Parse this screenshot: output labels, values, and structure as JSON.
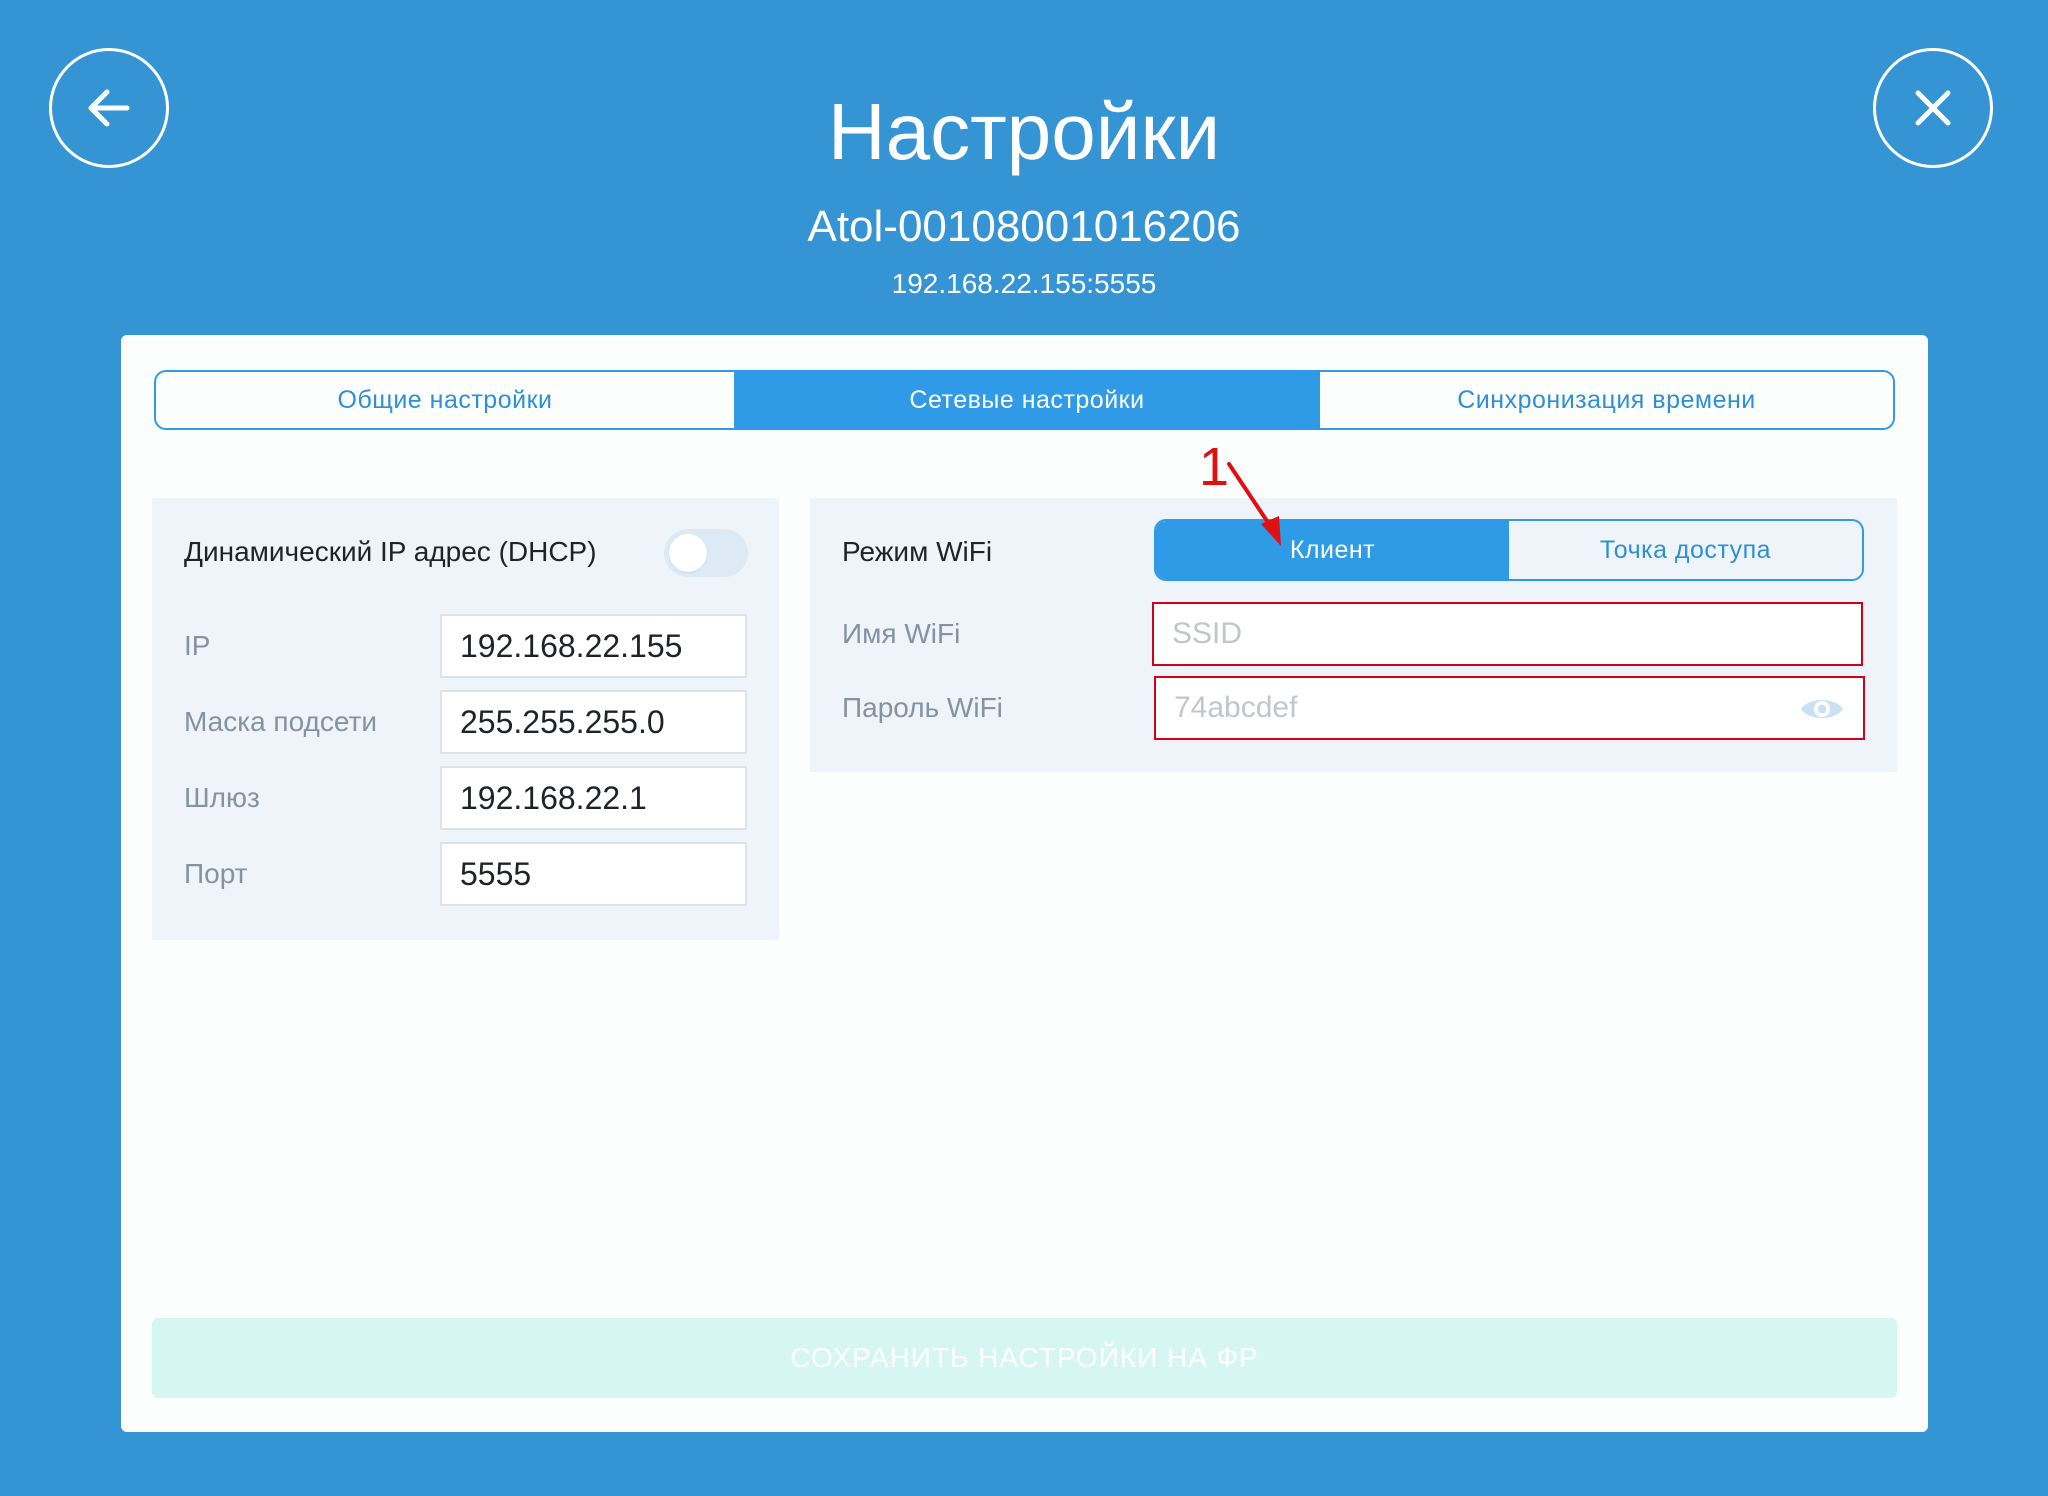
{
  "header": {
    "title": "Настройки",
    "device_name": "Atol-00108001016206",
    "device_address": "192.168.22.155:5555"
  },
  "tabs": [
    {
      "label": "Общие настройки",
      "active": false
    },
    {
      "label": "Сетевые настройки",
      "active": true
    },
    {
      "label": "Синхронизация времени",
      "active": false
    }
  ],
  "network": {
    "dhcp_label": "Динамический IP адрес (DHCP)",
    "dhcp_enabled": false,
    "ip_label": "IP",
    "ip_value": "192.168.22.155",
    "mask_label": "Маска подсети",
    "mask_value": "255.255.255.0",
    "gateway_label": "Шлюз",
    "gateway_value": "192.168.22.1",
    "port_label": "Порт",
    "port_value": "5555"
  },
  "wifi": {
    "mode_label": "Режим WiFi",
    "mode_client": "Клиент",
    "mode_ap": "Точка доступа",
    "selected_mode": "Клиент",
    "name_label": "Имя WiFi",
    "name_placeholder": "SSID",
    "password_label": "Пароль WiFi",
    "password_placeholder": "74abcdef"
  },
  "save_label": "СОХРАНИТЬ НАСТРОЙКИ НА ФР",
  "annotation": {
    "number": "1"
  },
  "colors": {
    "background": "#3494d4",
    "accent": "#2f9be6",
    "error_border": "#d0021b",
    "annotation": "#e01010",
    "save_disabled_bg": "#d6f7f1"
  },
  "icons": {
    "back": "arrow-left-icon",
    "close": "close-icon",
    "show_password": "eye-icon"
  }
}
